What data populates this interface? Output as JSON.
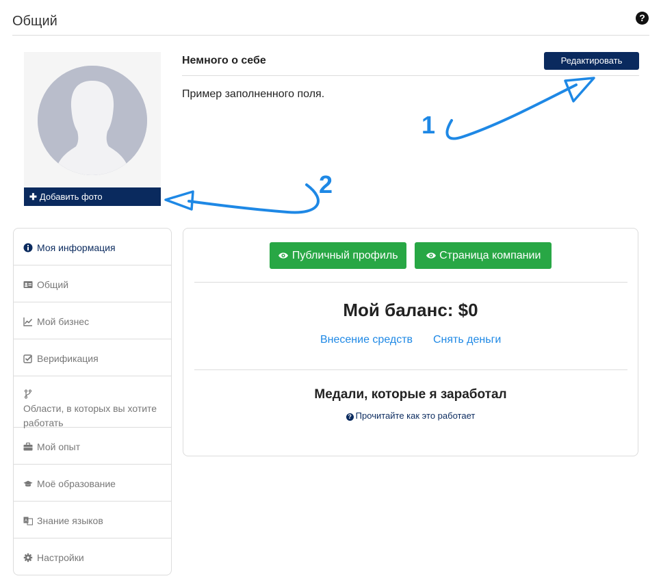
{
  "header": {
    "title": "Общий",
    "help_icon": "question-circle-icon"
  },
  "profile": {
    "add_photo_label": "Добавить фото",
    "about_title": "Немного о себе",
    "edit_label": "Редактировать",
    "about_text": "Пример заполненного поля."
  },
  "annotations": {
    "first": "1",
    "second": "2",
    "color": "#1e88e5"
  },
  "sidebar": {
    "items": [
      {
        "label": "Моя информация",
        "icon": "info-circle-icon",
        "active": true
      },
      {
        "label": "Общий",
        "icon": "id-card-icon"
      },
      {
        "label": "Мой бизнес",
        "icon": "line-chart-icon"
      },
      {
        "label": "Верификация",
        "icon": "check-square-icon"
      },
      {
        "label": "Области, в которых вы хотите работать",
        "icon": "code-fork-icon"
      },
      {
        "label": "Мой опыт",
        "icon": "briefcase-icon"
      },
      {
        "label": "Моё образование",
        "icon": "graduation-cap-icon"
      },
      {
        "label": "Знание языков",
        "icon": "language-icon"
      },
      {
        "label": "Настройки",
        "icon": "cog-icon"
      }
    ]
  },
  "main": {
    "public_profile": "Публичный профиль",
    "company_page": "Страница компании",
    "balance": "Мой баланс: $0",
    "deposit": "Внесение средств",
    "withdraw": "Снять деньги",
    "medals_title": "Медали, которые я заработал",
    "how_it_works": "Прочитайте как это работает"
  },
  "colors": {
    "brand_navy": "#0a2a5e",
    "green": "#28a745",
    "link_blue": "#1e88e5"
  }
}
